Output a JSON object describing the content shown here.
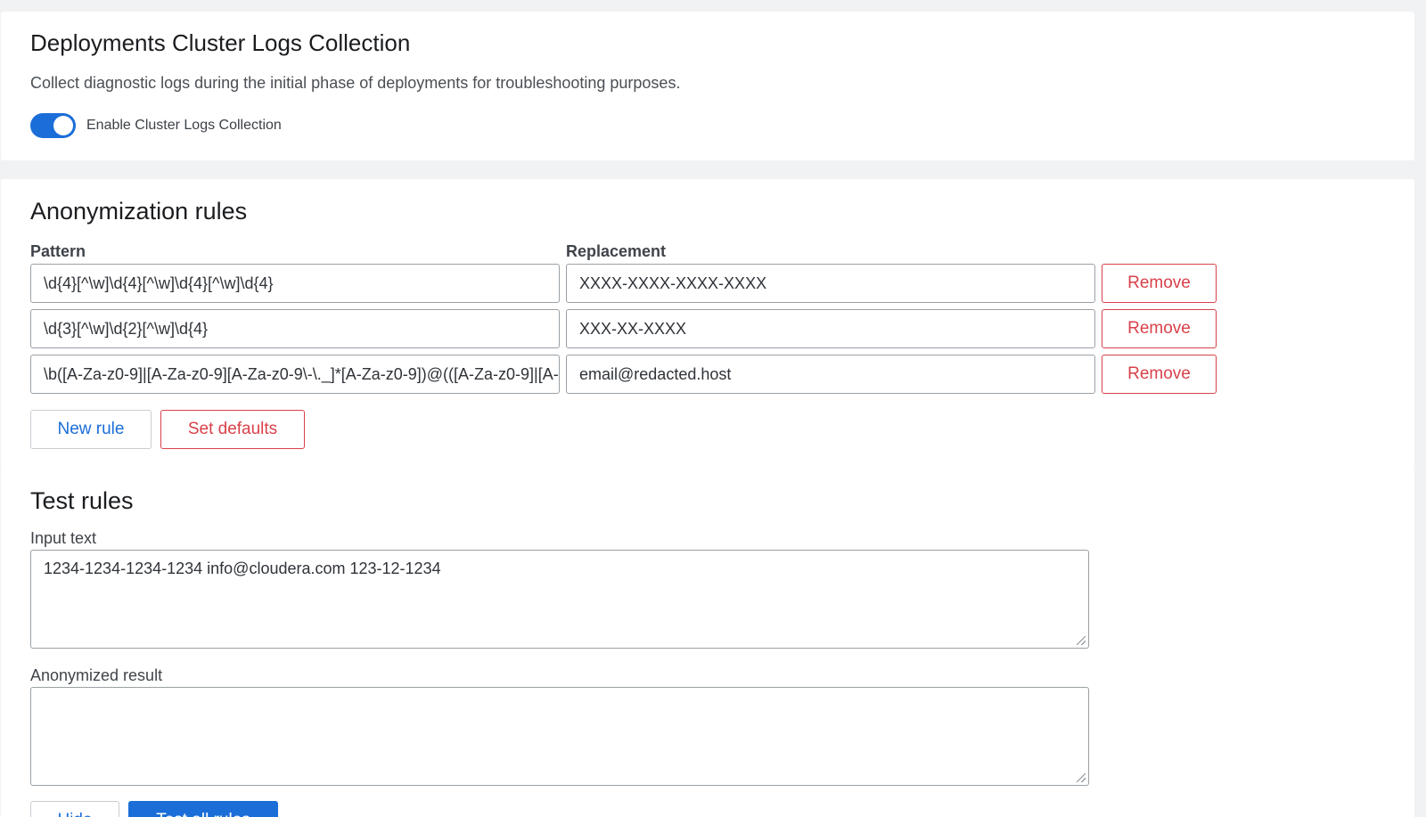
{
  "logs": {
    "title": "Deployments Cluster Logs Collection",
    "description": "Collect diagnostic logs during the initial phase of deployments for troubleshooting purposes.",
    "toggle_label": "Enable Cluster Logs Collection",
    "toggle_on": true
  },
  "anon": {
    "title": "Anonymization rules",
    "pattern_label": "Pattern",
    "replacement_label": "Replacement",
    "rules": [
      {
        "pattern": "\\d{4}[^\\w]\\d{4}[^\\w]\\d{4}[^\\w]\\d{4}",
        "replacement": "XXXX-XXXX-XXXX-XXXX",
        "remove_label": "Remove"
      },
      {
        "pattern": "\\d{3}[^\\w]\\d{2}[^\\w]\\d{4}",
        "replacement": "XXX-XX-XXXX",
        "remove_label": "Remove"
      },
      {
        "pattern": "\\b([A-Za-z0-9]|[A-Za-z0-9][A-Za-z0-9\\-\\._]*[A-Za-z0-9])@(([A-Za-z0-9]|[A-",
        "replacement": "email@redacted.host",
        "remove_label": "Remove"
      }
    ],
    "new_rule_label": "New rule",
    "set_defaults_label": "Set defaults"
  },
  "test": {
    "title": "Test rules",
    "input_label": "Input text",
    "input_value": "1234-1234-1234-1234 info@cloudera.com 123-12-1234",
    "result_label": "Anonymized result",
    "result_value": "",
    "hide_label": "Hide",
    "test_all_label": "Test all rules"
  },
  "colors": {
    "accent": "#1b6ed8",
    "danger": "#d9414a",
    "background": "#f1f2f4"
  }
}
